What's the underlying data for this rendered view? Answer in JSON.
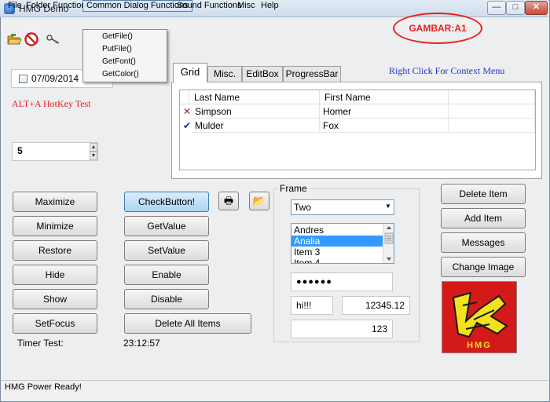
{
  "window": {
    "title": "HMG Demo",
    "minimize_glyph": "—",
    "maximize_glyph": "□",
    "close_glyph": "✕"
  },
  "menubar": {
    "items": [
      "File",
      "Folder Functions",
      "Common Dialog Functions",
      "Sound Functions",
      "Misc",
      "Help"
    ]
  },
  "dropdown": {
    "items": [
      "GetFile()",
      "PutFile()",
      "GetFont()",
      "GetColor()"
    ]
  },
  "badge": {
    "text": "GAMBAR:A1",
    "color": "#e52222"
  },
  "toolbar": {
    "icons": [
      "folder-open-icon",
      "no-entry-icon",
      "key-icon"
    ]
  },
  "date_picker": {
    "value": "07/09/2014"
  },
  "hotkey_label": "ALT+A HotKey Test",
  "spinner": {
    "value": "5",
    "up_glyph": "▲",
    "down_glyph": "▼"
  },
  "tabs": [
    "Grid",
    "Misc.",
    "EditBox",
    "ProgressBar"
  ],
  "active_tab": "Grid",
  "context_hint": "Right Click For Context Menu",
  "grid": {
    "columns": [
      "Last Name",
      "First Name"
    ],
    "rows": [
      {
        "mark": "✕",
        "mark_color": "#b02020",
        "last": "Simpson",
        "first": "Homer"
      },
      {
        "mark": "✔",
        "mark_color": "#2020b0",
        "last": "Mulder",
        "first": "Fox"
      }
    ]
  },
  "left_buttons": [
    "Maximize",
    "Minimize",
    "Restore",
    "Hide",
    "Show",
    "SetFocus"
  ],
  "mid_buttons": [
    "CheckButton!",
    "GetValue",
    "SetValue",
    "Enable",
    "Disable",
    "Delete All Items"
  ],
  "icon_buttons": {
    "print": "🖶",
    "open": "📂"
  },
  "frame": {
    "label": "Frame",
    "combo_value": "Two",
    "combo_arrow": "▼",
    "list_items": [
      "Andres",
      "Analia",
      "Item 3",
      "Item 4"
    ],
    "list_selected": "Analia",
    "password_mask": "●●●●●●",
    "text_value": "hi!!!",
    "numeric_value": "12345.12",
    "int_value": "123"
  },
  "right_buttons": [
    "Delete Item",
    "Add Item",
    "Messages",
    "Change Image"
  ],
  "logo": {
    "text": "HMG",
    "background": "#d41a18",
    "accent": "#f2e21e"
  },
  "timer": {
    "label": "Timer Test:",
    "value": "23:12:57"
  },
  "status": "HMG Power Ready!"
}
